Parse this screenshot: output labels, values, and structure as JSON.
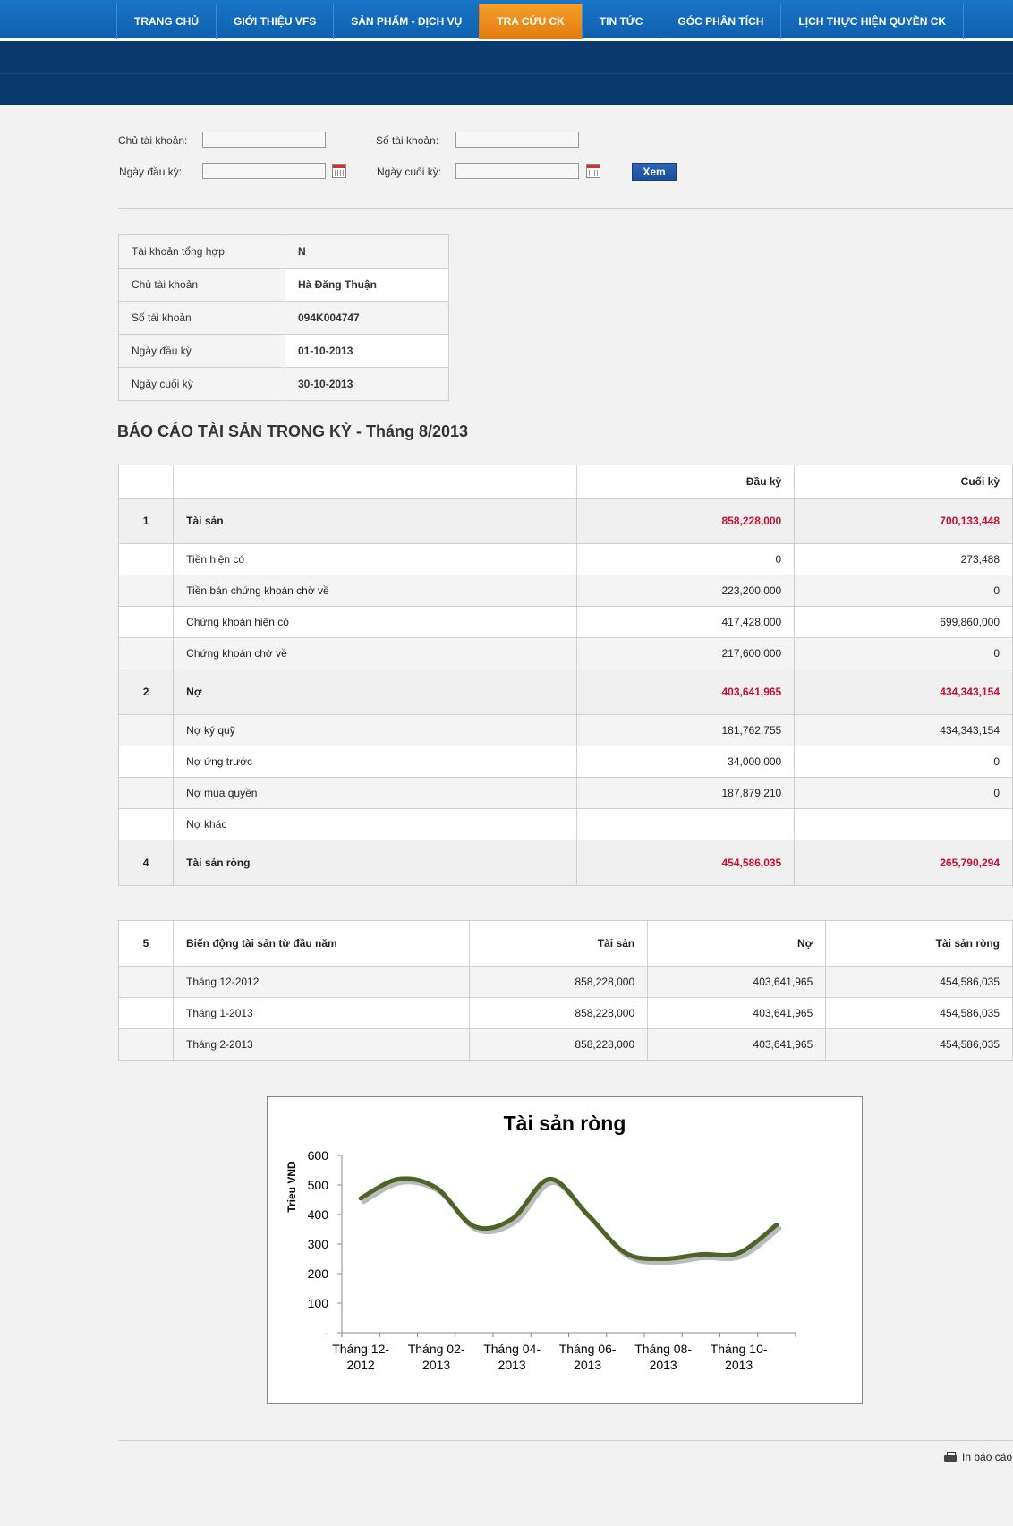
{
  "nav": {
    "items": [
      "TRANG CHỦ",
      "GIỚI THIỆU VFS",
      "SẢN PHẨM - DỊCH VỤ",
      "TRA CỨU CK",
      "TIN TỨC",
      "GÓC PHÂN TÍCH",
      "LỊCH THỰC HIỆN QUYỀN CK"
    ],
    "active": "TRA CỨU CK"
  },
  "form": {
    "owner_label": "Chủ tài khoản:",
    "account_label": "Số tài khoản:",
    "start_label": "Ngày đầu kỳ:",
    "end_label": "Ngày cuối kỳ:",
    "view_button": "Xem"
  },
  "info": {
    "rows": [
      {
        "label": "Tài khoản tổng hợp",
        "value": "N"
      },
      {
        "label": "Chủ tài khoản",
        "value": "Hà Đăng Thuận"
      },
      {
        "label": "Số tài khoản",
        "value": "094K004747"
      },
      {
        "label": "Ngày đầu kỳ",
        "value": "01-10-2013"
      },
      {
        "label": "Ngày cuối kỳ",
        "value": "30-10-2013"
      }
    ]
  },
  "report": {
    "title": "BÁO CÁO TÀI SẢN TRONG KỲ  -  Tháng 8/2013",
    "head": {
      "start": "Đầu kỳ",
      "end": "Cuối kỳ"
    },
    "rows": [
      {
        "no": "1",
        "label": "Tài sản",
        "start": "858,228,000",
        "end": "700,133,448",
        "section": true
      },
      {
        "no": "",
        "label": "Tiền hiện có",
        "start": "0",
        "end": "273,488"
      },
      {
        "no": "",
        "label": "Tiền bán chứng khoán chờ về",
        "start": "223,200,000",
        "end": "0"
      },
      {
        "no": "",
        "label": "Chứng khoán hiện có",
        "start": "417,428,000",
        "end": "699,860,000"
      },
      {
        "no": "",
        "label": "Chứng khoán chờ về",
        "start": "217,600,000",
        "end": "0"
      },
      {
        "no": "2",
        "label": "Nợ",
        "start": "403,641,965",
        "end": "434,343,154",
        "section": true
      },
      {
        "no": "",
        "label": "Nợ ký quỹ",
        "start": "181,762,755",
        "end": "434,343,154"
      },
      {
        "no": "",
        "label": "Nợ ứng trước",
        "start": "34,000,000",
        "end": "0"
      },
      {
        "no": "",
        "label": "Nợ mua quyền",
        "start": "187,879,210",
        "end": "0"
      },
      {
        "no": "",
        "label": "Nợ khác",
        "start": "",
        "end": ""
      },
      {
        "no": "4",
        "label": "Tài sản ròng",
        "start": "454,586,035",
        "end": "265,790,294",
        "section": true
      }
    ]
  },
  "variation": {
    "no": "5",
    "title": "Biến động tài sản từ đầu năm",
    "col_assets": "Tài sản",
    "col_debt": "Nợ",
    "col_net": "Tài sản ròng",
    "rows": [
      {
        "month": "Tháng 12-2012",
        "assets": "858,228,000",
        "debt": "403,641,965",
        "net": "454,586,035"
      },
      {
        "month": "Tháng 1-2013",
        "assets": "858,228,000",
        "debt": "403,641,965",
        "net": "454,586,035"
      },
      {
        "month": "Tháng 2-2013",
        "assets": "858,228,000",
        "debt": "403,641,965",
        "net": "454,586,035"
      }
    ]
  },
  "chart_data": {
    "type": "line",
    "title": "Tài sản ròng",
    "ylabel": "Trieu VND",
    "xlabel": "",
    "ylim": [
      0,
      600
    ],
    "yticks": [
      "-",
      "100",
      "200",
      "300",
      "400",
      "500",
      "600"
    ],
    "x_tick_labels": [
      "Tháng 12-2012",
      "Tháng 02-2013",
      "Tháng 04-2013",
      "Tháng 06-2013",
      "Tháng 08-2013",
      "Tháng 10-2013"
    ],
    "x": [
      "Tháng 12-2012",
      "Tháng 01-2013",
      "Tháng 02-2013",
      "Tháng 03-2013",
      "Tháng 04-2013",
      "Tháng 05-2013",
      "Tháng 06-2013",
      "Tháng 07-2013",
      "Tháng 08-2013",
      "Tháng 09-2013",
      "Tháng 10-2013",
      "Tháng 11-2013"
    ],
    "series": [
      {
        "values": [
          455,
          520,
          490,
          360,
          385,
          520,
          400,
          270,
          250,
          265,
          270,
          365
        ],
        "color": "#4f6228"
      }
    ],
    "grid": false,
    "legend": "none"
  },
  "footer": {
    "print_label": "In báo cáo"
  }
}
